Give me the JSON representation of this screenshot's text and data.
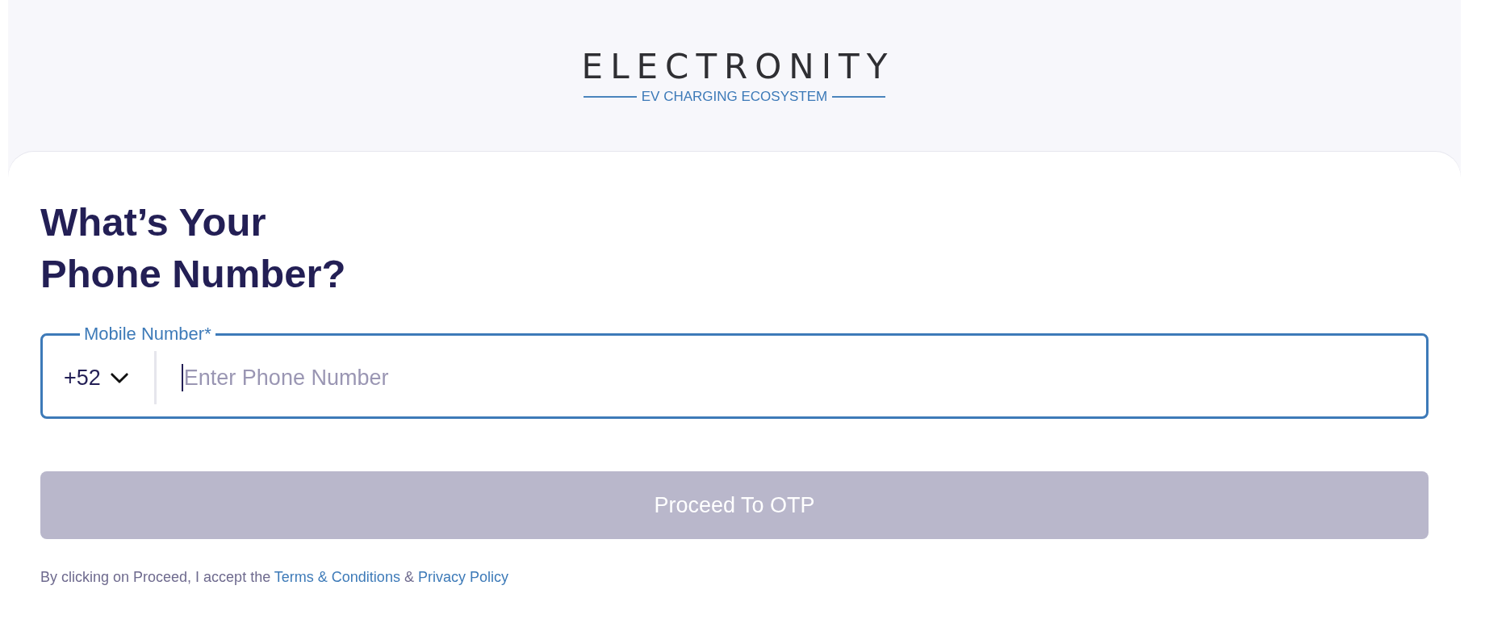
{
  "logo": {
    "wordmark": "ELECTRONITY",
    "tagline": "EV CHARGING ECOSYSTEM"
  },
  "heading": {
    "lines": [
      "What’s Your",
      "Phone Number?"
    ]
  },
  "phone_field": {
    "label": "Mobile Number*",
    "focused": true,
    "country_code": {
      "value": "+52"
    },
    "placeholder": "Enter Phone Number"
  },
  "submit_button": {
    "label": "Proceed To OTP",
    "disabled": true
  },
  "consent": {
    "text": "By clicking on Proceed, I accept the",
    "links": [
      {
        "label": "Terms & Conditions"
      },
      {
        "label": "Privacy Policy"
      }
    ],
    "separator": "&"
  }
}
